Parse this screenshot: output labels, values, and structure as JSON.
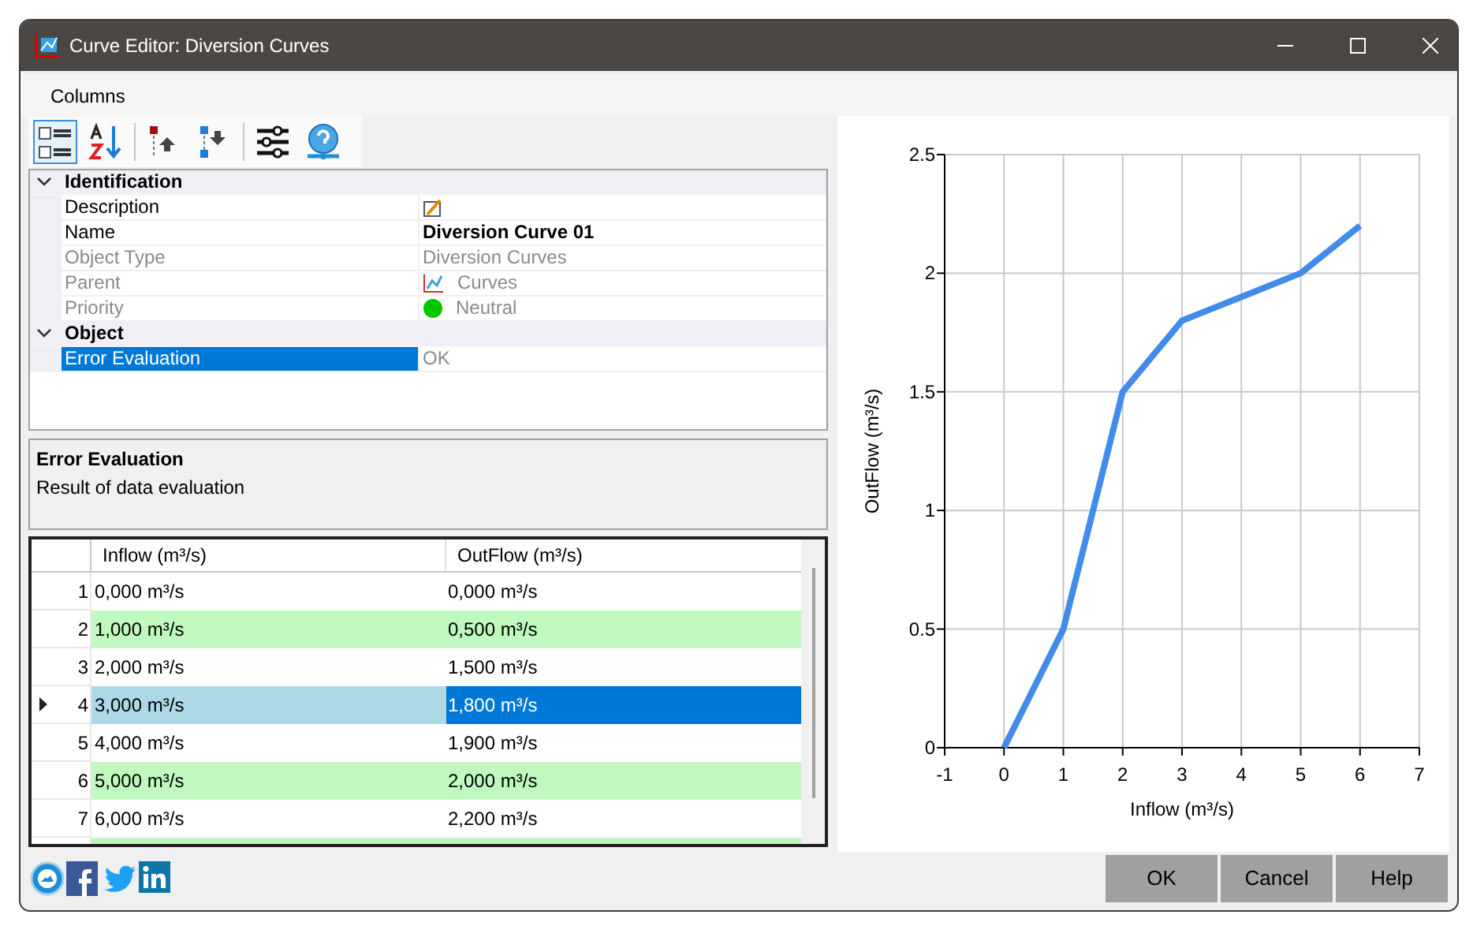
{
  "window": {
    "title": "Curve Editor: Diversion Curves"
  },
  "menu": [
    "Columns"
  ],
  "toolbar": [
    {
      "kind": "categorized",
      "selected": true
    },
    {
      "kind": "alphabetical",
      "selected": false
    },
    {
      "kind": "move-up",
      "selected": false
    },
    {
      "kind": "move-down",
      "selected": false
    },
    {
      "kind": "settings",
      "selected": false
    },
    {
      "kind": "help",
      "selected": false
    }
  ],
  "properties": [
    {
      "category": "Identification",
      "expanded": true,
      "items": [
        {
          "name": "Description",
          "value": "",
          "kind": "edit",
          "disabled": false,
          "selected": false
        },
        {
          "name": "Name",
          "value": "Diversion Curve 01",
          "kind": "bold",
          "disabled": false,
          "selected": false
        },
        {
          "name": "Object Type",
          "value": "Diversion Curves",
          "kind": "text",
          "disabled": true,
          "selected": false
        },
        {
          "name": "Parent",
          "value": "Curves",
          "kind": "chart",
          "disabled": true,
          "selected": false
        },
        {
          "name": "Priority",
          "value": "Neutral",
          "kind": "dot",
          "color": "#00c800",
          "disabled": true,
          "selected": false
        }
      ]
    },
    {
      "category": "Object",
      "expanded": true,
      "items": [
        {
          "name": "Error Evaluation",
          "value": "OK",
          "kind": "text",
          "disabled": true,
          "selected": true
        }
      ]
    }
  ],
  "description": {
    "title": "Error Evaluation",
    "text": "Result of data evaluation"
  },
  "table": {
    "columns": [
      "Inflow (m³/s)",
      "OutFlow (m³/s)"
    ],
    "rows": [
      {
        "number": "1",
        "inflow": "0,000 m³/s",
        "outflow": "0,000 m³/s",
        "selected": false
      },
      {
        "number": "2",
        "inflow": "1,000 m³/s",
        "outflow": "0,500 m³/s",
        "selected": false
      },
      {
        "number": "3",
        "inflow": "2,000 m³/s",
        "outflow": "1,500 m³/s",
        "selected": false
      },
      {
        "number": "4",
        "inflow": "3,000 m³/s",
        "outflow": "1,800 m³/s",
        "selected": true
      },
      {
        "number": "5",
        "inflow": "4,000 m³/s",
        "outflow": "1,900 m³/s",
        "selected": false
      },
      {
        "number": "6",
        "inflow": "5,000 m³/s",
        "outflow": "2,000 m³/s",
        "selected": false
      },
      {
        "number": "7",
        "inflow": "6,000 m³/s",
        "outflow": "2,200 m³/s",
        "selected": false
      }
    ]
  },
  "chart": {
    "chart_data": {
      "type": "line",
      "xlabel": "Inflow (m³/s)",
      "ylabel": "OutFlow (m³/s)",
      "x": [
        0,
        1,
        2,
        3,
        4,
        5,
        6
      ],
      "grid": true,
      "series": [
        {
          "color": "#428bea",
          "values": [
            0,
            0.5,
            1.5,
            1.8,
            1.9,
            2,
            2.2
          ]
        }
      ],
      "xlim": [
        -1,
        7
      ],
      "ylim": [
        0,
        2.5
      ],
      "xticks": [
        -1,
        0,
        1,
        2,
        3,
        4,
        5,
        6,
        7
      ],
      "yticks": [
        0,
        0.5,
        1,
        1.5,
        2,
        2.5
      ]
    }
  },
  "social": [
    {
      "kind": "site"
    },
    {
      "kind": "facebook"
    },
    {
      "kind": "twitter"
    },
    {
      "kind": "linkedin"
    }
  ],
  "buttons": [
    "OK",
    "Cancel",
    "Help"
  ]
}
